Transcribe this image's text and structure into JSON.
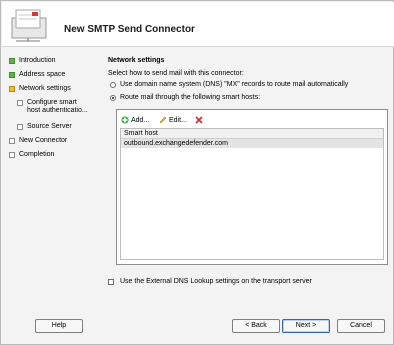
{
  "dialog": {
    "title": "New SMTP Send Connector"
  },
  "steps": [
    {
      "label": "Introduction",
      "state": "done"
    },
    {
      "label": "Address space",
      "state": "done"
    },
    {
      "label": "Network settings",
      "state": "current"
    },
    {
      "label_line1": "Configure smart",
      "label_line2": "host authenticatio...",
      "state": "todo"
    },
    {
      "label": "Source Server",
      "state": "todo"
    },
    {
      "label": "New Connector",
      "state": "todo"
    },
    {
      "label": "Completion",
      "state": "todo"
    }
  ],
  "network": {
    "section_title": "Network settings",
    "description": "Select how to send mail with this connector:",
    "option_dns": "Use domain name system (DNS) \"MX\" records to route mail automatically",
    "option_smart": "Route mail through the following smart hosts:",
    "selected": "smart"
  },
  "toolbar": {
    "add": "Add...",
    "edit": "Edit...",
    "remove_icon": "red-x-icon"
  },
  "smart_hosts": {
    "column_header": "Smart host",
    "rows": [
      "outbound.exchangedefender.com"
    ]
  },
  "external_dns": {
    "label": "Use the External DNS Lookup settings on the transport server",
    "checked": false
  },
  "buttons": {
    "help": "Help",
    "back": "< Back",
    "next": "Next >",
    "cancel": "Cancel"
  },
  "colors": {
    "done": "#5db447",
    "current": "#f0c028",
    "remove": "#d22a2a",
    "add": "#3aa63a"
  }
}
